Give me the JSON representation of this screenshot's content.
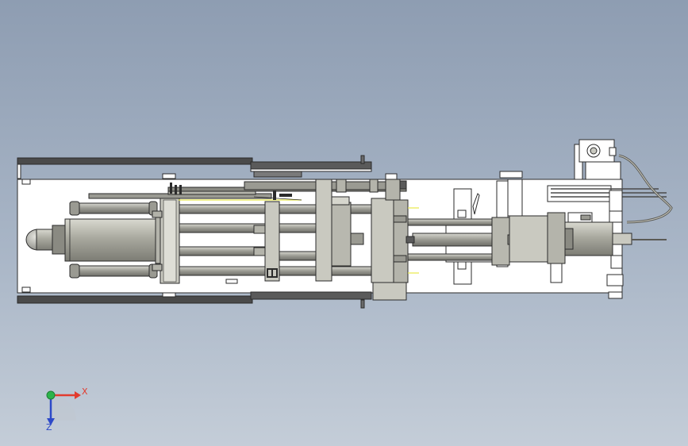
{
  "viewport": {
    "background_top": "#8e9db2",
    "background_bottom": "#c4cdd8"
  },
  "model": {
    "frame_color": "#ffffff",
    "outline_color": "#2b2b2b",
    "part_color": "#c9c9c0",
    "part_dark_color": "#9e9e95",
    "rail_color": "#4a4a4a",
    "cylinder_color": "#a9a99f",
    "highlight_color": "#e8e84a",
    "hose_color": "#5a5a55"
  },
  "triad": {
    "x_label": "X",
    "z_label": "Z",
    "x_color": "#e23b2e",
    "z_color": "#2d49c8",
    "y_color": "#2cb34a"
  }
}
